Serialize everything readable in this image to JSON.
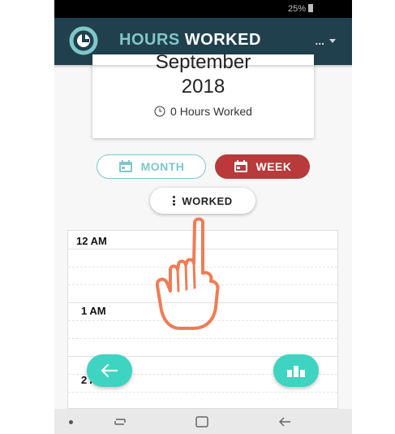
{
  "status_bar": {
    "battery": "25%"
  },
  "app_bar": {
    "title_highlight": "HOURS",
    "title_rest": "WORKED",
    "overflow_label": "..."
  },
  "date_card": {
    "month": "September",
    "year": "2018",
    "hours_worked": "0 Hours Worked"
  },
  "view_toggle": {
    "month_label": "MONTH",
    "week_label": "WEEK",
    "active": "WEEK"
  },
  "filter": {
    "label": "WORKED"
  },
  "calendar": {
    "time_labels": [
      "12 AM",
      "1 AM",
      "2 AM"
    ]
  },
  "icons": {
    "logo": "clock-logo-icon",
    "month": "calendar-icon",
    "week": "calendar-icon",
    "filter": "kebab-icon",
    "back": "arrow-left-icon",
    "stats": "bar-chart-icon"
  },
  "colors": {
    "app_bar": "#21404e",
    "accent_teal": "#7fc7c9",
    "active_red": "#b83a3b",
    "fab": "#3fd3c1",
    "hand_stroke": "#f07b55"
  }
}
